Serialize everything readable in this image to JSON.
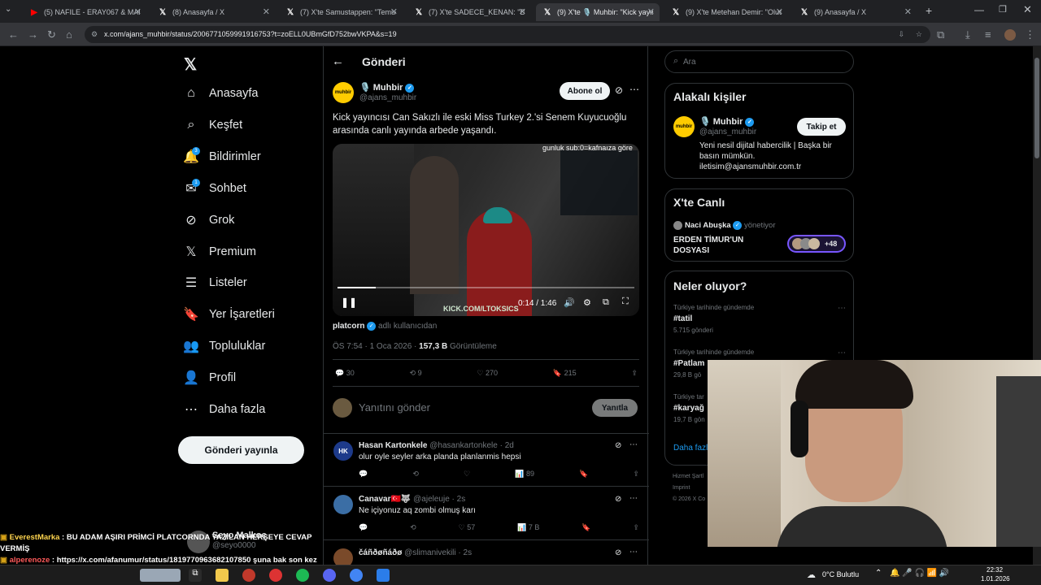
{
  "tabs": [
    {
      "title": "(5) NAFILE - ERAY067 & MANS...",
      "icon": "youtube-icon",
      "color": "#ff0000",
      "active": false
    },
    {
      "title": "(8) Anasayfa / X",
      "icon": "x-logo-icon",
      "active": false
    },
    {
      "title": "(7) X'te Samustappen: \"Temuda...",
      "icon": "x-logo-icon",
      "active": false
    },
    {
      "title": "(7) X'te SADECE_KENAN: \"Deli...",
      "icon": "x-logo-icon",
      "active": false
    },
    {
      "title": "(9) X'te 🎙️ Muhbir: \"Kick yayınc...",
      "icon": "x-logo-icon",
      "active": true
    },
    {
      "title": "(9) X'te Metehan Demir: \"Olucu...",
      "icon": "x-logo-icon",
      "active": false
    },
    {
      "title": "(9) Anasayfa / X",
      "icon": "x-logo-icon",
      "active": false
    }
  ],
  "url": "x.com/ajans_muhbir/status/2006771059991916753?t=zoELL0UBmGfD752bwVKPA&s=19",
  "nav": [
    {
      "label": "Anasayfa",
      "icon": "home-icon",
      "glyph": "⌂"
    },
    {
      "label": "Keşfet",
      "icon": "search-icon",
      "glyph": "⌕"
    },
    {
      "label": "Bildirimler",
      "icon": "bell-icon",
      "glyph": "🔔",
      "badge": "3"
    },
    {
      "label": "Sohbet",
      "icon": "mail-icon",
      "glyph": "✉",
      "badge": "1"
    },
    {
      "label": "Grok",
      "icon": "grok-icon",
      "glyph": "⊘"
    },
    {
      "label": "Premium",
      "icon": "x-logo-icon",
      "glyph": "𝕏"
    },
    {
      "label": "Listeler",
      "icon": "list-icon",
      "glyph": "☰"
    },
    {
      "label": "Yer İşaretleri",
      "icon": "bookmark-icon",
      "glyph": "🔖"
    },
    {
      "label": "Topluluklar",
      "icon": "communities-icon",
      "glyph": "👥"
    },
    {
      "label": "Profil",
      "icon": "profile-icon",
      "glyph": "👤"
    },
    {
      "label": "Daha fazla",
      "icon": "more-circle-icon",
      "glyph": "⋯"
    }
  ],
  "post_button": "Gönderi yayınla",
  "sidebar_user": "Seyo Malkoç",
  "sidebar_handle": "@seyo0000",
  "header": {
    "title": "Gönderi"
  },
  "post": {
    "author": "🎙️ Muhbir",
    "handle": "@ajans_muhbir",
    "avatar_text": "muhbir",
    "subscribe": "Abone ol",
    "text": "Kick yayıncısı Can Sakızlı ile eski Miss Turkey 2.'si Senem Kuyucuoğlu arasında canlı yayında arbede yaşandı.",
    "video_time": "0:14 / 1:46",
    "video_progress": 0.13,
    "overlay_text": "gunluk sub:0=kafnaıza göre",
    "watermark": "KICK.COM/LTOKSICS",
    "source_user": "platcorn",
    "source_suffix": "adlı kullanıcıdan",
    "time": "ÖS 7:54 · 1 Oca 2026 · ",
    "views": "157,3 B",
    "views_label": "Görüntüleme",
    "replies": "30",
    "reposts": "9",
    "likes": "270",
    "bookmarks": "215"
  },
  "reply_box": {
    "placeholder": "Yanıtını gönder",
    "button": "Yanıtla"
  },
  "replies": [
    {
      "name": "Hasan Kartonkele",
      "handle": "@hasankartonkele · 2d",
      "text": "olur oyle seyler arka planda planlanmis hepsi",
      "likes": "",
      "views": "89",
      "avatar": "HK",
      "color": "#1d3a8a"
    },
    {
      "name": "Canavar🇹🇷🐺",
      "handle": "@ajeleuje · 2s",
      "text": "Ne içiyonuz aq zombi olmuş karı",
      "likes": "57",
      "views": "7 B",
      "avatar": "",
      "color": "#3b6ea5"
    },
    {
      "name": "čáñðøñáðø",
      "handle": "@slimanivekili · 2s",
      "text": "",
      "likes": "",
      "views": "",
      "avatar": "",
      "color": "#7a4a2a"
    }
  ],
  "search": {
    "placeholder": "Ara"
  },
  "related": {
    "title": "Alakalı kişiler",
    "name": "🎙️ Muhbir",
    "handle": "@ajans_muhbir",
    "follow": "Takip et",
    "bio": "Yeni nesil dijital habercilik | Başka bir basın mümkün. iletisim@ajansmuhbir.com.tr"
  },
  "live": {
    "title": "X'te Canlı",
    "host": "Naci Abuşka",
    "role": "yönetiyor",
    "space": "ERDEN TİMUR'UN DOSYASI",
    "count": "+48"
  },
  "trends": {
    "title": "Neler oluyor?",
    "items": [
      {
        "context": "Türkiye tarihinde gündemde",
        "tag": "#tatil",
        "count": "5.715 gönderi"
      },
      {
        "context": "Türkiye tarihinde gündemde",
        "tag": "#Patlam",
        "count": "29,8 B gö"
      },
      {
        "context": "Türkiye tar",
        "tag": "#karyağ",
        "count": "19,7 B gön"
      }
    ],
    "more": "Daha fazl"
  },
  "footer": [
    "Hizmet Şartl",
    "Imprint",
    "© 2026 X Co"
  ],
  "chat": [
    {
      "user": "EverestMarka",
      "msg": " : BU ADAM AŞIRI PRİMCİ PLATCORNDA YAZILAN HERŞEYE CEVAP VERMİŞ",
      "color": "#ffd54f"
    },
    {
      "user": "alperenoze",
      "msg": " : https://x.com/afanumur/status/1819770963682107850 şuna bak son kez yatıyom bb",
      "color": "#ff5a5a"
    }
  ],
  "taskbar": {
    "weather": "0°C Bulutlu",
    "time": "22:32",
    "date": "1.01.2026"
  }
}
